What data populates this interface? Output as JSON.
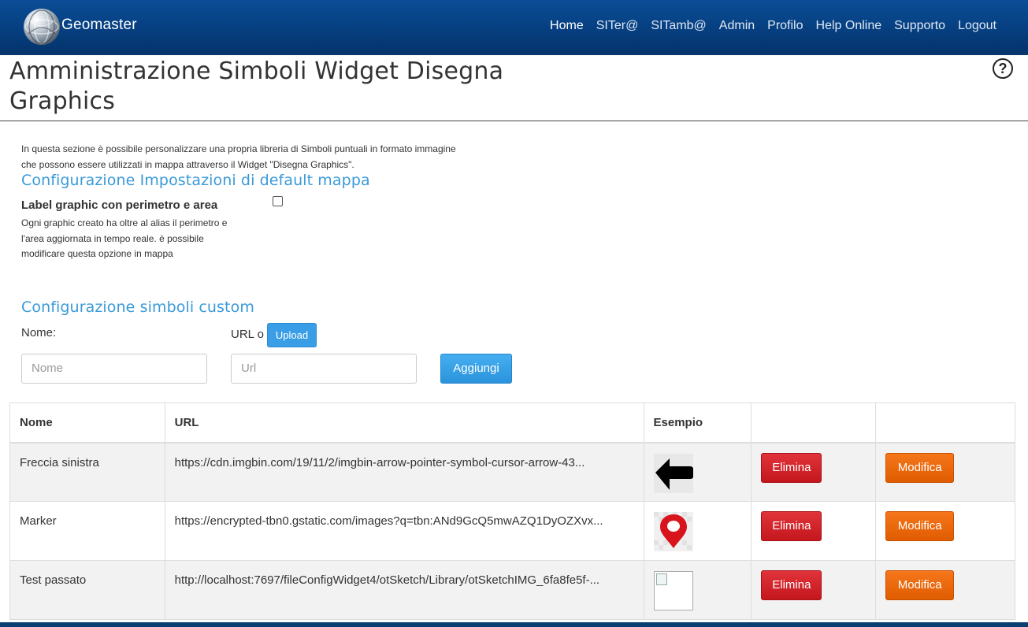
{
  "brand": {
    "name": "Geomaster",
    "logo_icon": "globe-logo-icon"
  },
  "nav": {
    "items": [
      {
        "label": "Home",
        "active": true
      },
      {
        "label": "SITer@"
      },
      {
        "label": "SITamb@"
      },
      {
        "label": "Admin"
      },
      {
        "label": "Profilo"
      },
      {
        "label": "Help Online"
      },
      {
        "label": "Supporto"
      },
      {
        "label": "Logout"
      }
    ]
  },
  "page": {
    "title_line1": "Amministrazione Simboli Widget Disegna",
    "title_line2": "Graphics",
    "help_icon": "?",
    "intro_line1": "In questa sezione è possibile personalizzare una propria libreria di Simboli puntuali in formato immagine",
    "intro_line2": "che possono essere utilizzati in mappa attraverso il Widget \"Disegna Graphics\"."
  },
  "defaults": {
    "heading": "Configurazione Impostazioni di default mappa",
    "option_label": "Label graphic con perimetro e area",
    "option_desc_line1": "Ogni graphic creato ha oltre al alias il perimetro e",
    "option_desc_line2": "l'area aggiornata in tempo reale. è possibile",
    "option_desc_line3": "modificare questa opzione in mappa",
    "option_checked": false
  },
  "custom": {
    "heading": "Configurazione simboli custom",
    "name_label": "Nome:",
    "url_label": "URL o",
    "upload_button": "Upload",
    "name_placeholder": "Nome",
    "url_placeholder": "Url",
    "add_button": "Aggiungi"
  },
  "table": {
    "headers": [
      "Nome",
      "URL",
      "Esempio",
      "",
      ""
    ],
    "rows": [
      {
        "name": "Freccia sinistra",
        "url": "https://cdn.imgbin.com/19/11/2/imgbin-arrow-pointer-symbol-cursor-arrow-43...",
        "preview": "left-arrow-icon",
        "delete": "Elimina",
        "edit": "Modifica"
      },
      {
        "name": "Marker",
        "url": "https://encrypted-tbn0.gstatic.com/images?q=tbn:ANd9GcQ5mwAZQ1DyOZXvx...",
        "preview": "map-marker-icon",
        "delete": "Elimina",
        "edit": "Modifica"
      },
      {
        "name": "Test passato",
        "url": "http://localhost:7697/fileConfigWidget4/otSketch/Library/otSketchIMG_6fa8fe5f-...",
        "preview": "broken-image-icon",
        "delete": "Elimina",
        "edit": "Modifica"
      }
    ]
  },
  "colors": {
    "navbar": "#063f80",
    "heading_accent": "#3a9ad9",
    "primary_button": "#3a9ee6",
    "danger_button": "#c4161d",
    "warning_button": "#e05d00"
  }
}
